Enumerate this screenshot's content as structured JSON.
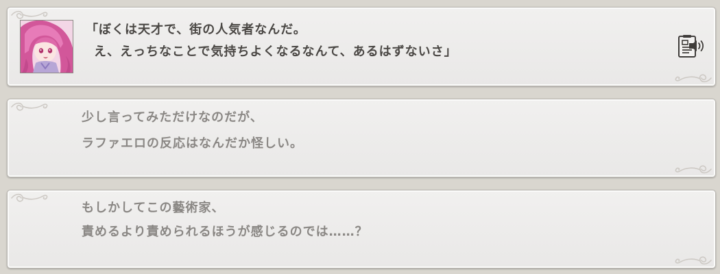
{
  "log": {
    "entries": [
      {
        "lines": [
          "「ぼくは天才で、街の人気者なんだ。",
          "え、えっちなことで気持ちよくなるなんて、あるはずないさ」"
        ],
        "has_portrait": true,
        "portrait_icon": "character-portrait",
        "voice_icon": "voice-replay-icon"
      },
      {
        "lines": [
          "少し言ってみただけなのだが、",
          "ラファエロの反応はなんだか怪しい。"
        ]
      },
      {
        "lines": [
          "もしかしてこの藝術家、",
          "責めるより責められるほうが感じるのでは……？"
        ]
      }
    ]
  },
  "colors": {
    "background": "#d9d6cf",
    "panel": "#eceae9",
    "panel_border": "#b9b6b1",
    "speaker_text": "#4a4744",
    "narration_text": "#8a8784",
    "ornament": "#c9c6c2"
  }
}
